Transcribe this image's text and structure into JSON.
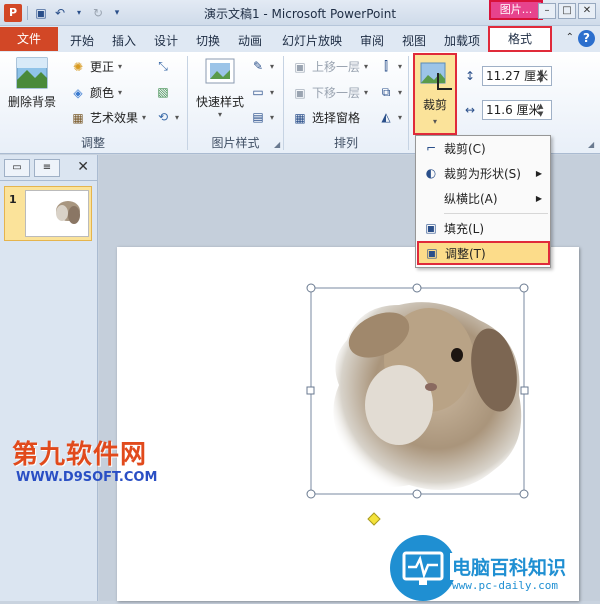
{
  "app": {
    "window_title": "演示文稿1 - Microsoft PowerPoint",
    "context_tab": "图片..."
  },
  "window_buttons": [
    "–",
    "□",
    "✕"
  ],
  "tabs": {
    "file": "文件",
    "items": [
      "开始",
      "插入",
      "设计",
      "切换",
      "动画",
      "幻灯片放映",
      "审阅",
      "视图",
      "加载项"
    ],
    "active": "格式"
  },
  "ribbon": {
    "adjust": {
      "remove_bg": "删除背景",
      "corrections": "更正",
      "color": "颜色",
      "artistic": "艺术效果",
      "label": "调整"
    },
    "picture_styles": {
      "quick_styles": "快速样式",
      "label": "图片样式"
    },
    "arrange": {
      "bring_forward": "上移一层",
      "send_backward": "下移一层",
      "selection_pane": "选择窗格",
      "label": "排列"
    },
    "size": {
      "crop": "裁剪",
      "height": "11.27 厘米",
      "width": "11.6 厘米"
    }
  },
  "crop_menu": {
    "items": [
      {
        "label": "裁剪(C)",
        "arrow": false
      },
      {
        "label": "裁剪为形状(S)",
        "arrow": true
      },
      {
        "label": "纵横比(A)",
        "arrow": true
      },
      {
        "label": "填充(L)",
        "arrow": false
      },
      {
        "label": "调整(T)",
        "arrow": false
      }
    ]
  },
  "left_panel": {
    "slide_number": "1"
  },
  "watermarks": {
    "site1_name": "第九软件网",
    "site1_url": "WWW.D9SOFT.COM",
    "site2_name": "电脑百科知识",
    "site2_url": "www.pc-daily.com"
  }
}
